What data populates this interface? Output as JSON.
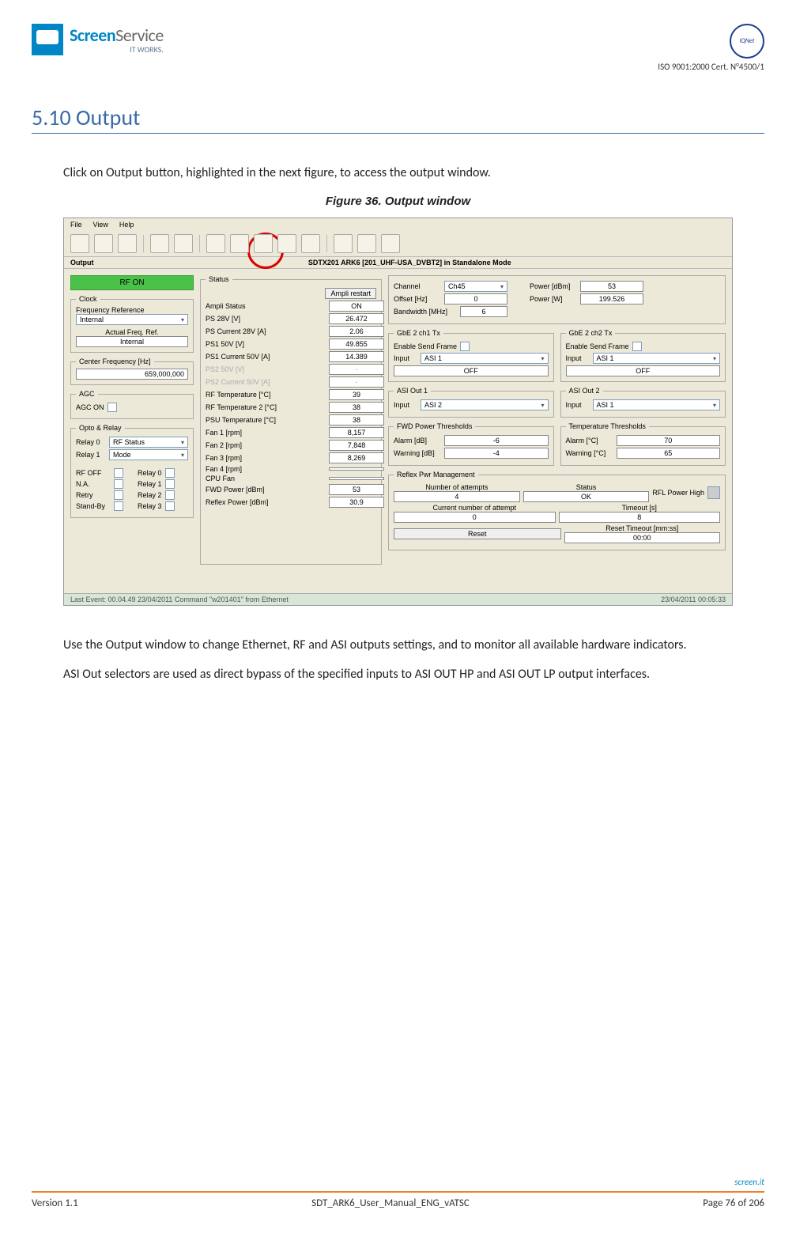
{
  "header": {
    "logo_screen": "Screen",
    "logo_service": "Service",
    "logo_sub": "IT WORKS.",
    "cert": "ISO 9001:2000 Cert. N°4500/1"
  },
  "section": {
    "title": "5.10 Output",
    "intro": "Click on Output button, highlighted in the next figure, to access the output window.",
    "figure_caption": "Figure 36.    Output window",
    "para1": "Use the Output window to change Ethernet, RF and ASI outputs settings, and to monitor all available hardware indicators.",
    "para2": "ASI Out selectors are used as direct bypass of the specified inputs to ASI OUT HP and ASI OUT LP output interfaces."
  },
  "app": {
    "menu": {
      "file": "File",
      "view": "View",
      "help": "Help"
    },
    "subheader_left": "Output",
    "subheader_title": "SDTX201 ARK6 [201_UHF-USA_DVBT2] in Standalone Mode",
    "rf_on": "RF ON",
    "clock": {
      "legend": "Clock",
      "freq_ref_label": "Frequency Reference",
      "freq_ref_value": "Internal",
      "actual_label": "Actual Freq. Ref.",
      "actual_value": "Internal"
    },
    "center_freq": {
      "legend": "Center Frequency [Hz]",
      "value": "659,000,000"
    },
    "agc": {
      "legend": "AGC",
      "agc_on": "AGC ON"
    },
    "opto": {
      "legend": "Opto & Relay",
      "relay0": "Relay 0",
      "relay0_sel": "RF Status",
      "relay1": "Relay 1",
      "relay1_sel": "Mode",
      "rfoff": "RF OFF",
      "rfoff_r": "Relay 0",
      "na": "N.A.",
      "na_r": "Relay 1",
      "retry": "Retry",
      "retry_r": "Relay 2",
      "standby": "Stand-By",
      "standby_r": "Relay 3"
    },
    "status": {
      "legend": "Status",
      "ampli_restart": "Ampli restart",
      "rows": [
        {
          "label": "Ampli Status",
          "value": "ON"
        },
        {
          "label": "PS 28V [V]",
          "value": "26.472"
        },
        {
          "label": "PS Current 28V [A]",
          "value": "2.06"
        },
        {
          "label": "PS1 50V [V]",
          "value": "49.855"
        },
        {
          "label": "PS1 Current 50V [A]",
          "value": "14.389"
        },
        {
          "label": "PS2 50V [V]",
          "value": "-"
        },
        {
          "label": "PS2 Current 50V [A]",
          "value": "-"
        },
        {
          "label": "RF Temperature [°C]",
          "value": "39"
        },
        {
          "label": "RF Temperature 2 [°C]",
          "value": "38"
        },
        {
          "label": "PSU Temperature [°C]",
          "value": "38"
        },
        {
          "label": "Fan 1 [rpm]",
          "value": "8,157"
        },
        {
          "label": "Fan 2 [rpm]",
          "value": "7,848"
        },
        {
          "label": "Fan 3 [rpm]",
          "value": "8,269"
        },
        {
          "label": "Fan 4 [rpm]",
          "value": ""
        },
        {
          "label": "CPU Fan",
          "value": ""
        },
        {
          "label": "FWD Power [dBm]",
          "value": "53"
        },
        {
          "label": "Reflex Power [dBm]",
          "value": "30.9"
        }
      ]
    },
    "top_right": {
      "channel_label": "Channel",
      "channel_value": "Ch45",
      "offset_label": "Offset [Hz]",
      "offset_value": "0",
      "bw_label": "Bandwidth [MHz]",
      "bw_value": "6",
      "power_dbm_label": "Power [dBm]",
      "power_dbm_value": "53",
      "power_w_label": "Power [W]",
      "power_w_value": "199.526"
    },
    "gbe1": {
      "legend": "GbE 2 ch1 Tx",
      "enable": "Enable Send Frame",
      "input_label": "Input",
      "input_value": "ASI 1",
      "off": "OFF"
    },
    "gbe2": {
      "legend": "GbE 2 ch2 Tx",
      "enable": "Enable Send Frame",
      "input_label": "Input",
      "input_value": "ASI 1",
      "off": "OFF"
    },
    "asi1": {
      "legend": "ASI Out 1",
      "input_label": "Input",
      "input_value": "ASI 2"
    },
    "asi2": {
      "legend": "ASI Out 2",
      "input_label": "Input",
      "input_value": "ASI 1"
    },
    "fwd_thr": {
      "legend": "FWD Power Thresholds",
      "alarm_label": "Alarm [dB]",
      "alarm_value": "-6",
      "warn_label": "Warning [dB]",
      "warn_value": "-4"
    },
    "temp_thr": {
      "legend": "Temperature Thresholds",
      "alarm_label": "Alarm [°C]",
      "alarm_value": "70",
      "warn_label": "Warning [°C]",
      "warn_value": "65"
    },
    "reflex": {
      "legend": "Reflex Pwr Management",
      "attempts_label": "Number of attempts",
      "attempts_value": "4",
      "status_label": "Status",
      "status_value": "OK",
      "rfl_high": "RFL Power High",
      "current_label": "Current number of attempt",
      "current_value": "0",
      "timeout_label": "Timeout [s]",
      "timeout_value": "8",
      "reset": "Reset",
      "reset_to_label": "Reset Timeout [mm:ss]",
      "reset_to_value": "00:00"
    },
    "footer_left": "Last Event: 00.04.49 23/04/2011 Command \"w201401\" from Ethernet",
    "footer_right": "23/04/2011 00:05:33"
  },
  "footer": {
    "version": "Version 1.1",
    "doc": "SDT_ARK6_User_Manual_ENG_vATSC",
    "page": "Page 76 of 206",
    "brand": "screen.it"
  }
}
